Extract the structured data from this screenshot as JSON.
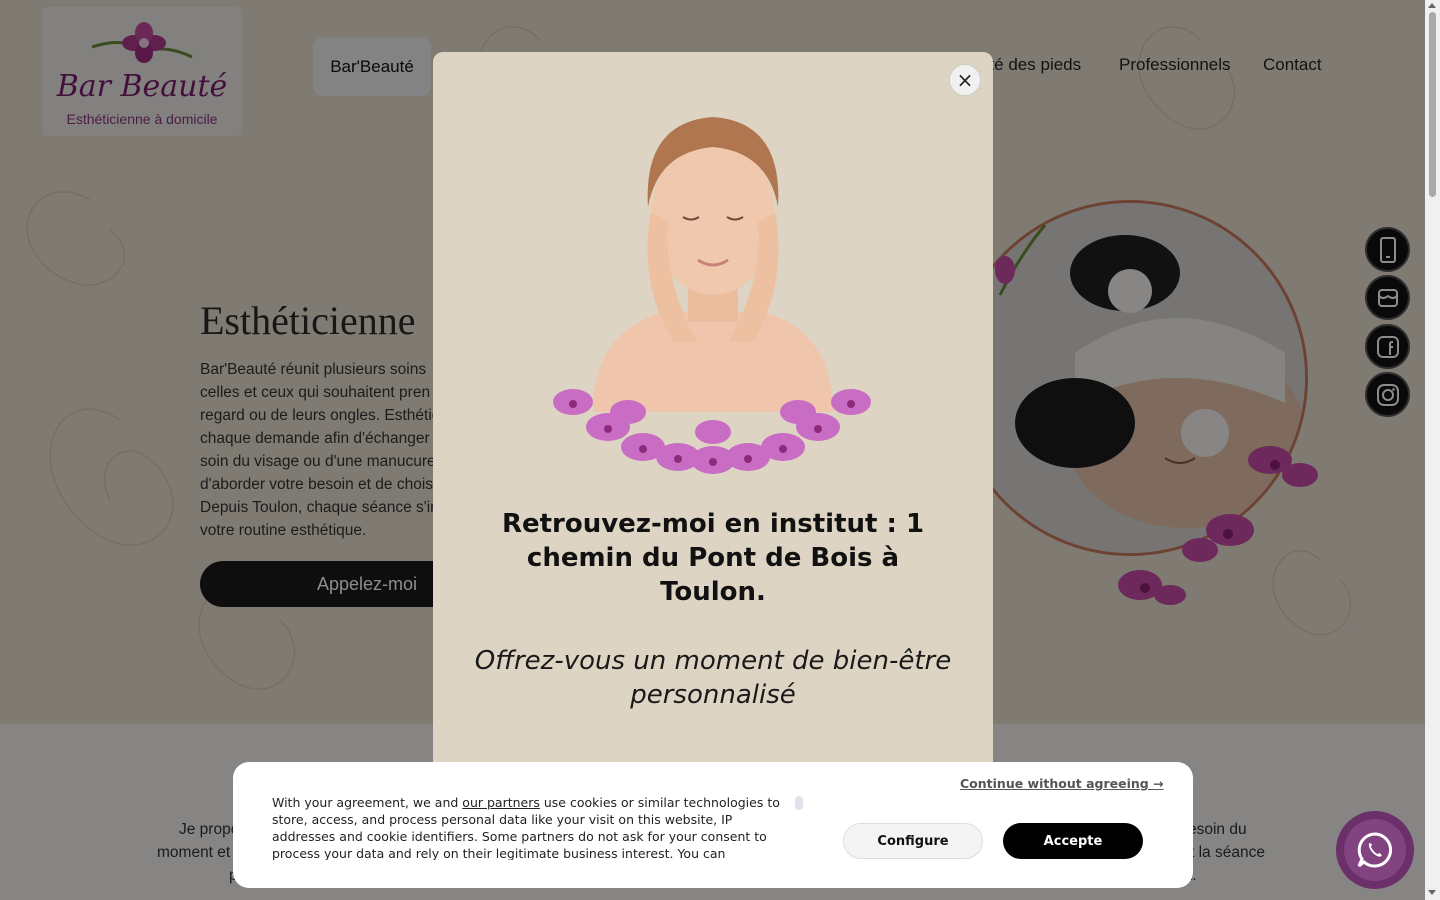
{
  "brand": {
    "logo_script": "Bar Beauté",
    "logo_sub": "Esthéticienne à domicile"
  },
  "nav": {
    "active": "Bar'Beauté",
    "items": [
      "uté des pieds",
      "Professionnels",
      "Contact"
    ]
  },
  "hero": {
    "title": "Esthéticienne",
    "lines": [
      "Bar'Beauté réunit plusieurs soins",
      "celles et ceux qui souhaitent pren",
      "regard ou de leurs ongles. Esthétic",
      "chaque demande afin d'échanger",
      "soin du visage ou d'une manucure",
      "d'aborder votre besoin et de chois",
      "Depuis Toulon, chaque séance s'in",
      "votre routine esthétique."
    ],
    "cta": "Appelez-moi"
  },
  "below": {
    "left_lines": [
      "Je propo",
      "moment et",
      "p"
    ],
    "right_lines": [
      "esoin du",
      "t la séance",
      "t."
    ]
  },
  "social": [
    "phone-icon",
    "store-icon",
    "facebook-icon",
    "instagram-icon"
  ],
  "modal": {
    "close": "×",
    "title": "Retrouvez-moi en institut : 1 chemin du Pont de Bois à Toulon.",
    "subtitle": "Offrez-vous un moment de bien-être personnalisé"
  },
  "cookie": {
    "text_before_link": "With your agreement, we and ",
    "link": "our partners",
    "text_after_link": " use cookies or similar technologies to store, access, and process personal data like your visit on this website, IP addresses and cookie identifiers. Some partners do not ask for your consent to process your data and rely on their legitimate business interest. You can",
    "continue": "Continue without agreeing →",
    "configure": "Configure",
    "accept": "Accepte"
  },
  "colors": {
    "accent_purple": "#824381",
    "hero_bg": "#e8e0d2",
    "modal_bg": "#ddd4c3"
  }
}
